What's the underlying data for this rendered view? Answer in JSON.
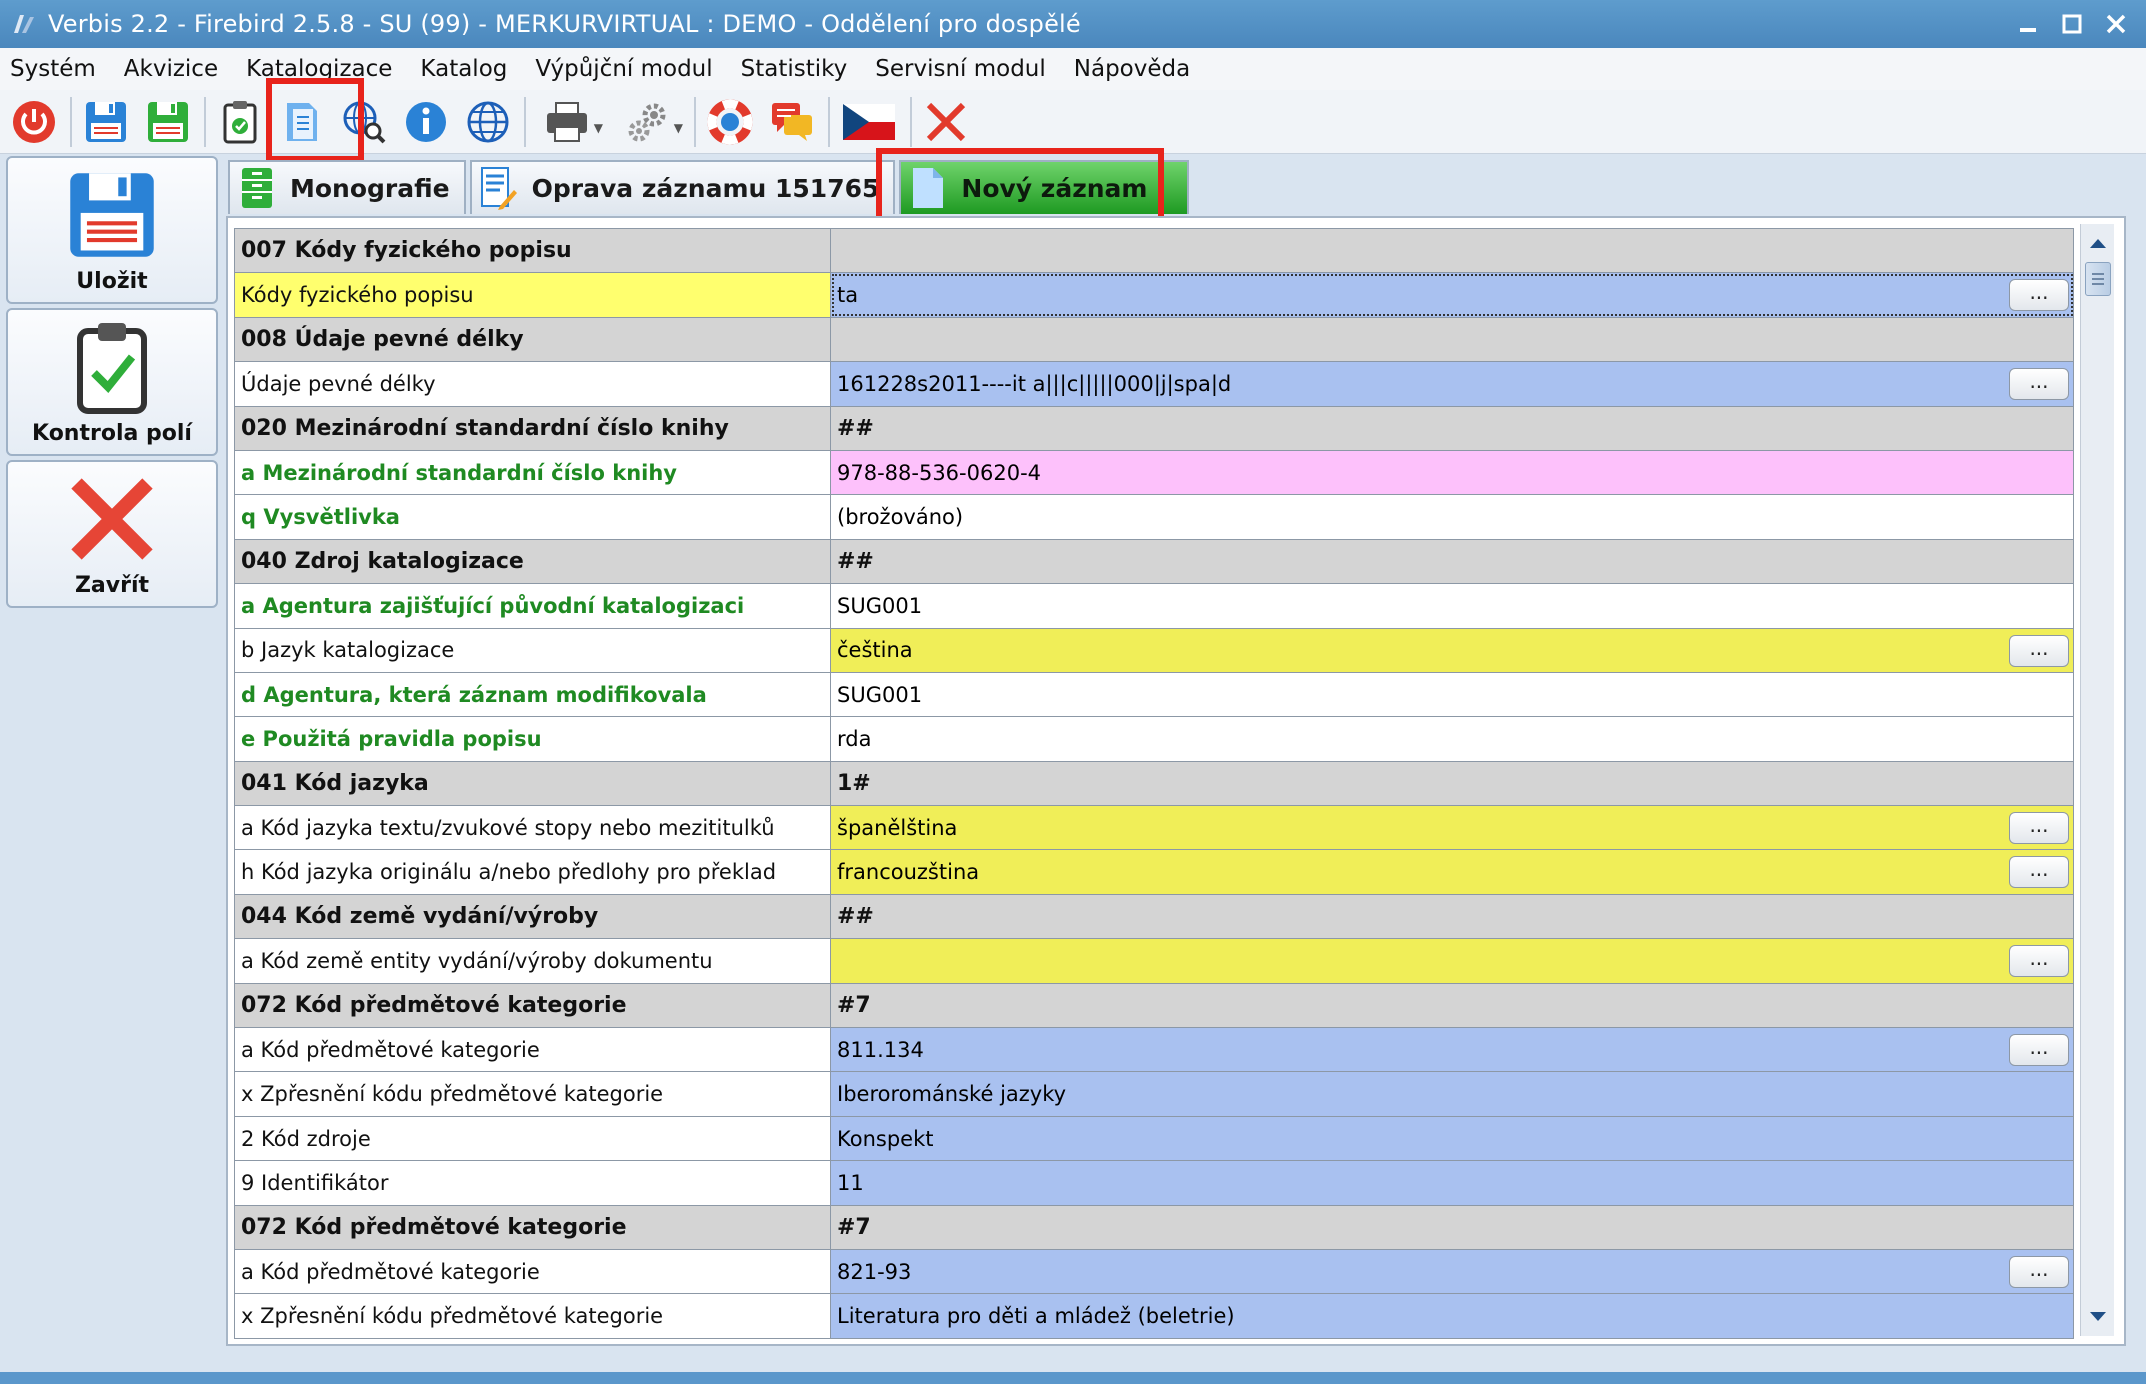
{
  "window": {
    "title": "Verbis 2.2 - Firebird 2.5.8 - SU (99) - MERKURVIRTUAL : DEMO - Oddělení pro dospělé"
  },
  "menu": [
    "Systém",
    "Akvizice",
    "Katalogizace",
    "Katalog",
    "Výpůjční modul",
    "Statistiky",
    "Servisní modul",
    "Nápověda"
  ],
  "sidebar": {
    "save_label": "Uložit",
    "check_label": "Kontrola polí",
    "close_label": "Zavřít"
  },
  "tabs": [
    {
      "label": "Monografie"
    },
    {
      "label": "Oprava záznamu 151765"
    },
    {
      "label": "Nový záznam",
      "active": true
    }
  ],
  "grid": {
    "rows": [
      {
        "type": "hdr",
        "label": "007 Kódy fyzického popisu",
        "value": ""
      },
      {
        "type": "sub",
        "label": "Kódy fyzického popisu",
        "value": "ta",
        "value_color": "blue",
        "btn": true,
        "label_yellow": true,
        "focus": true
      },
      {
        "type": "hdr",
        "label": "008 Údaje pevné délky",
        "value": ""
      },
      {
        "type": "sub",
        "label": "Údaje pevné délky",
        "value": "161228s2011----it a|||c|||||000|j|spa|d",
        "value_color": "blue",
        "btn": true
      },
      {
        "type": "hdr",
        "label": "020 Mezinárodní standardní číslo knihy",
        "value": "##"
      },
      {
        "type": "sub",
        "label": "a Mezinárodní standardní číslo knihy",
        "value": "978-88-536-0620-4",
        "value_color": "pink",
        "required": true
      },
      {
        "type": "sub",
        "label": "q Vysvětlivka",
        "value": "(brožováno)",
        "value_color": "white",
        "required": true
      },
      {
        "type": "hdr",
        "label": "040 Zdroj katalogizace",
        "value": "##"
      },
      {
        "type": "sub",
        "label": "a Agentura zajišťující původní katalogizaci",
        "value": "SUG001",
        "value_color": "white",
        "required": true
      },
      {
        "type": "sub",
        "label": "b Jazyk katalogizace",
        "value": "čeština",
        "value_color": "yellow",
        "btn": true
      },
      {
        "type": "sub",
        "label": "d Agentura, která záznam modifikovala",
        "value": "SUG001",
        "value_color": "white",
        "required": true
      },
      {
        "type": "sub",
        "label": "e Použitá pravidla popisu",
        "value": "rda",
        "value_color": "white",
        "required": true
      },
      {
        "type": "hdr",
        "label": "041 Kód jazyka",
        "value": "1#"
      },
      {
        "type": "sub",
        "label": "a Kód jazyka textu/zvukové stopy nebo mezititulků",
        "value": "španělština",
        "value_color": "yellow",
        "btn": true
      },
      {
        "type": "sub",
        "label": "h Kód jazyka originálu a/nebo předlohy pro překlad",
        "value": "francouzština",
        "value_color": "yellow",
        "btn": true
      },
      {
        "type": "hdr",
        "label": "044 Kód země vydání/výroby",
        "value": "##"
      },
      {
        "type": "sub",
        "label": "a Kód země entity vydání/výroby dokumentu",
        "value": "",
        "value_color": "yellow",
        "btn": true
      },
      {
        "type": "hdr",
        "label": "072 Kód předmětové kategorie",
        "value": "#7"
      },
      {
        "type": "sub",
        "label": "a Kód předmětové kategorie",
        "value": "811.134",
        "value_color": "blue",
        "btn": true
      },
      {
        "type": "sub",
        "label": "x Zpřesnění kódu předmětové kategorie",
        "value": "Iberorománské jazyky",
        "value_color": "blue"
      },
      {
        "type": "sub",
        "label": "2 Kód zdroje",
        "value": "Konspekt",
        "value_color": "blue"
      },
      {
        "type": "sub",
        "label": "9 Identifikátor",
        "value": "11",
        "value_color": "blue"
      },
      {
        "type": "hdr",
        "label": "072 Kód předmětové kategorie",
        "value": "#7"
      },
      {
        "type": "sub",
        "label": "a Kód předmětové kategorie",
        "value": "821-93",
        "value_color": "blue",
        "btn": true
      },
      {
        "type": "sub",
        "label": "x Zpřesnění kódu předmětové kategorie",
        "value": "Literatura pro děti a mládež (beletrie)",
        "value_color": "blue"
      }
    ],
    "button_label": "..."
  }
}
